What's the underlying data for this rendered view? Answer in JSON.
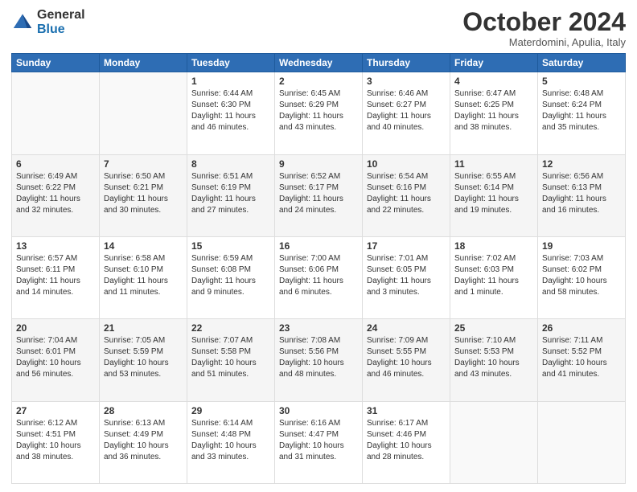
{
  "header": {
    "logo_line1": "General",
    "logo_line2": "Blue",
    "month_title": "October 2024",
    "subtitle": "Materdomini, Apulia, Italy"
  },
  "days_of_week": [
    "Sunday",
    "Monday",
    "Tuesday",
    "Wednesday",
    "Thursday",
    "Friday",
    "Saturday"
  ],
  "weeks": [
    [
      {
        "day": "",
        "info": ""
      },
      {
        "day": "",
        "info": ""
      },
      {
        "day": "1",
        "info": "Sunrise: 6:44 AM\nSunset: 6:30 PM\nDaylight: 11 hours and 46 minutes."
      },
      {
        "day": "2",
        "info": "Sunrise: 6:45 AM\nSunset: 6:29 PM\nDaylight: 11 hours and 43 minutes."
      },
      {
        "day": "3",
        "info": "Sunrise: 6:46 AM\nSunset: 6:27 PM\nDaylight: 11 hours and 40 minutes."
      },
      {
        "day": "4",
        "info": "Sunrise: 6:47 AM\nSunset: 6:25 PM\nDaylight: 11 hours and 38 minutes."
      },
      {
        "day": "5",
        "info": "Sunrise: 6:48 AM\nSunset: 6:24 PM\nDaylight: 11 hours and 35 minutes."
      }
    ],
    [
      {
        "day": "6",
        "info": "Sunrise: 6:49 AM\nSunset: 6:22 PM\nDaylight: 11 hours and 32 minutes."
      },
      {
        "day": "7",
        "info": "Sunrise: 6:50 AM\nSunset: 6:21 PM\nDaylight: 11 hours and 30 minutes."
      },
      {
        "day": "8",
        "info": "Sunrise: 6:51 AM\nSunset: 6:19 PM\nDaylight: 11 hours and 27 minutes."
      },
      {
        "day": "9",
        "info": "Sunrise: 6:52 AM\nSunset: 6:17 PM\nDaylight: 11 hours and 24 minutes."
      },
      {
        "day": "10",
        "info": "Sunrise: 6:54 AM\nSunset: 6:16 PM\nDaylight: 11 hours and 22 minutes."
      },
      {
        "day": "11",
        "info": "Sunrise: 6:55 AM\nSunset: 6:14 PM\nDaylight: 11 hours and 19 minutes."
      },
      {
        "day": "12",
        "info": "Sunrise: 6:56 AM\nSunset: 6:13 PM\nDaylight: 11 hours and 16 minutes."
      }
    ],
    [
      {
        "day": "13",
        "info": "Sunrise: 6:57 AM\nSunset: 6:11 PM\nDaylight: 11 hours and 14 minutes."
      },
      {
        "day": "14",
        "info": "Sunrise: 6:58 AM\nSunset: 6:10 PM\nDaylight: 11 hours and 11 minutes."
      },
      {
        "day": "15",
        "info": "Sunrise: 6:59 AM\nSunset: 6:08 PM\nDaylight: 11 hours and 9 minutes."
      },
      {
        "day": "16",
        "info": "Sunrise: 7:00 AM\nSunset: 6:06 PM\nDaylight: 11 hours and 6 minutes."
      },
      {
        "day": "17",
        "info": "Sunrise: 7:01 AM\nSunset: 6:05 PM\nDaylight: 11 hours and 3 minutes."
      },
      {
        "day": "18",
        "info": "Sunrise: 7:02 AM\nSunset: 6:03 PM\nDaylight: 11 hours and 1 minute."
      },
      {
        "day": "19",
        "info": "Sunrise: 7:03 AM\nSunset: 6:02 PM\nDaylight: 10 hours and 58 minutes."
      }
    ],
    [
      {
        "day": "20",
        "info": "Sunrise: 7:04 AM\nSunset: 6:01 PM\nDaylight: 10 hours and 56 minutes."
      },
      {
        "day": "21",
        "info": "Sunrise: 7:05 AM\nSunset: 5:59 PM\nDaylight: 10 hours and 53 minutes."
      },
      {
        "day": "22",
        "info": "Sunrise: 7:07 AM\nSunset: 5:58 PM\nDaylight: 10 hours and 51 minutes."
      },
      {
        "day": "23",
        "info": "Sunrise: 7:08 AM\nSunset: 5:56 PM\nDaylight: 10 hours and 48 minutes."
      },
      {
        "day": "24",
        "info": "Sunrise: 7:09 AM\nSunset: 5:55 PM\nDaylight: 10 hours and 46 minutes."
      },
      {
        "day": "25",
        "info": "Sunrise: 7:10 AM\nSunset: 5:53 PM\nDaylight: 10 hours and 43 minutes."
      },
      {
        "day": "26",
        "info": "Sunrise: 7:11 AM\nSunset: 5:52 PM\nDaylight: 10 hours and 41 minutes."
      }
    ],
    [
      {
        "day": "27",
        "info": "Sunrise: 6:12 AM\nSunset: 4:51 PM\nDaylight: 10 hours and 38 minutes."
      },
      {
        "day": "28",
        "info": "Sunrise: 6:13 AM\nSunset: 4:49 PM\nDaylight: 10 hours and 36 minutes."
      },
      {
        "day": "29",
        "info": "Sunrise: 6:14 AM\nSunset: 4:48 PM\nDaylight: 10 hours and 33 minutes."
      },
      {
        "day": "30",
        "info": "Sunrise: 6:16 AM\nSunset: 4:47 PM\nDaylight: 10 hours and 31 minutes."
      },
      {
        "day": "31",
        "info": "Sunrise: 6:17 AM\nSunset: 4:46 PM\nDaylight: 10 hours and 28 minutes."
      },
      {
        "day": "",
        "info": ""
      },
      {
        "day": "",
        "info": ""
      }
    ]
  ]
}
